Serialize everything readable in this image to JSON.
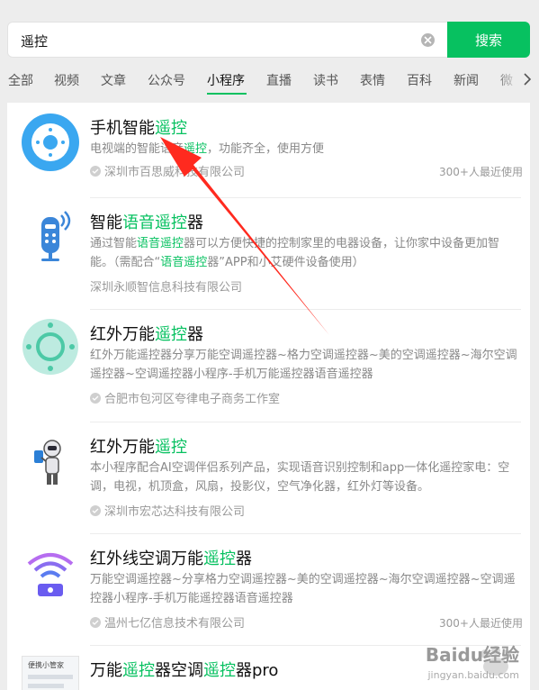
{
  "search": {
    "query": "遥控",
    "button_label": "搜索"
  },
  "tabs": [
    {
      "label": "全部",
      "active": false
    },
    {
      "label": "视频",
      "active": false
    },
    {
      "label": "文章",
      "active": false
    },
    {
      "label": "公众号",
      "active": false
    },
    {
      "label": "小程序",
      "active": true
    },
    {
      "label": "直播",
      "active": false
    },
    {
      "label": "读书",
      "active": false
    },
    {
      "label": "表情",
      "active": false
    },
    {
      "label": "百科",
      "active": false
    },
    {
      "label": "新闻",
      "active": false
    },
    {
      "label": "微",
      "active": false
    }
  ],
  "colors": {
    "accent": "#07c160",
    "annotation": "#ff2a1f"
  },
  "results": [
    {
      "title_a": "手机智能",
      "title_hl": "遥控",
      "title_b": "",
      "desc_a": "电视端的智能语音",
      "desc_hl": "遥控",
      "desc_b": "，功能齐全，使用方便",
      "company": "深圳市百思威科技有限公司",
      "recent": "300+人最近使用",
      "icon": "tv-remote-icon"
    },
    {
      "title_a": "智能",
      "title_hl": "语音遥控",
      "title_b": "器",
      "desc_a": "通过智能",
      "desc_hl": "语音遥控",
      "desc_b": "器可以方便快捷的控制家里的电器设备，让你家中设备更加智能。（需配合“",
      "desc_hl2": "语音遥控",
      "desc_c": "器”APP和小艾硬件设备使用）",
      "company": "深圳永顺智信息科技有限公司",
      "icon": "voice-remote-icon"
    },
    {
      "title_a": "红外万能",
      "title_hl": "遥控",
      "title_b": "器",
      "desc_full": "红外万能遥控器分享万能空调遥控器~格力空调遥控器~美的空调遥控器~海尔空调遥控器~空调遥控器小程序-手机万能遥控器语音遥控器",
      "company": "合肥市包河区夸律电子商务工作室",
      "icon": "ir-remote-icon"
    },
    {
      "title_a": "红外万能",
      "title_hl": "遥控",
      "title_b": "",
      "desc_full": "本小程序配合AI空调伴侣系列产品，实现语音识别控制和app一体化遥控家电：空调，电视，机顶盒，风扇，投影仪，空气净化器，红外灯等设备。",
      "company": "深圳市宏芯达科技有限公司",
      "icon": "robot-icon"
    },
    {
      "title_a": "红外线空调万能",
      "title_hl": "遥控",
      "title_b": "器",
      "desc_full": "万能空调遥控器~分享格力空调遥控器~美的空调遥控器~海尔空调遥控器~空调遥控器小程序-手机万能遥控器语音遥控器",
      "company": "温州七亿信息技术有限公司",
      "recent": "300+人最近使用",
      "icon": "wifi-remote-icon"
    },
    {
      "title_a": "万能",
      "title_hl": "遥控",
      "title_b": "器空调",
      "title_hl2": "遥控",
      "title_c": "器pro",
      "icon_caption": "便携小管家",
      "icon": "app-thumbnail-icon"
    }
  ],
  "watermark": {
    "text": "Baidu经验",
    "sub": "jingyan.baidu.com"
  }
}
